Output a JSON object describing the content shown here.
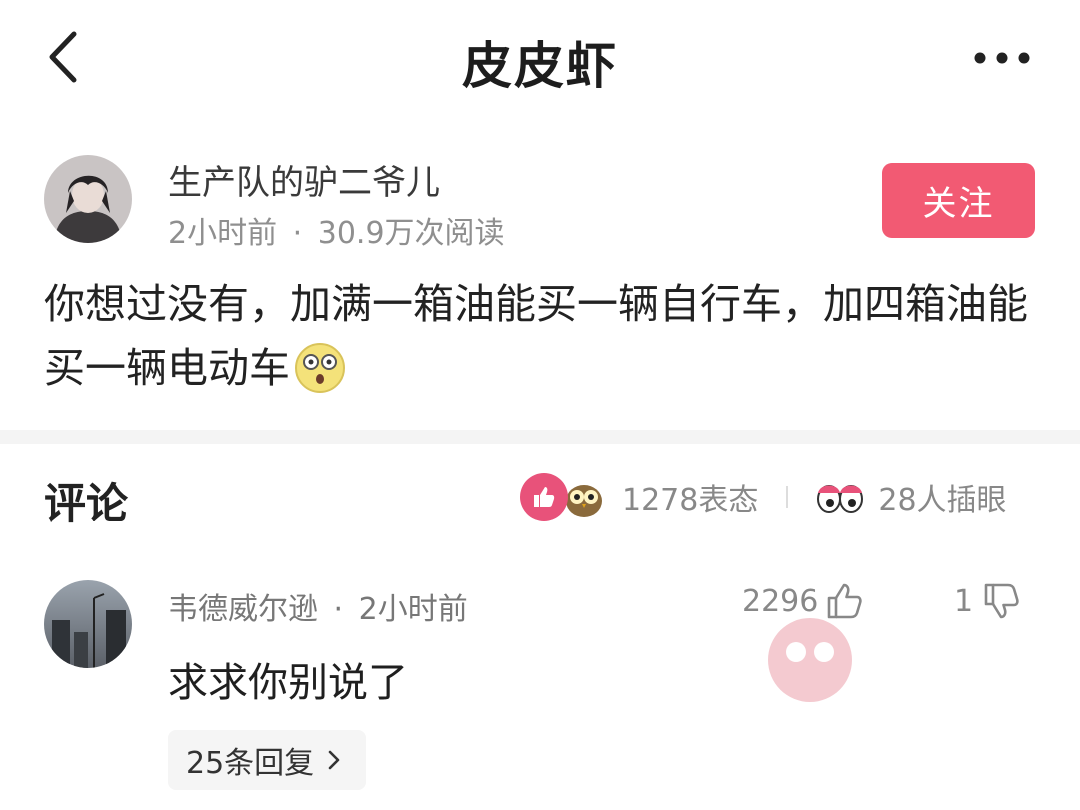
{
  "header": {
    "title": "皮皮虾",
    "back_icon": "chevron-left-icon",
    "more_icon": "more-dots-icon"
  },
  "post": {
    "author": "生产队的驴二爷儿",
    "time": "2小时前",
    "separator": "·",
    "reads": "30.9万次阅读",
    "follow_label": "关注",
    "text": "你想过没有，加满一箱油能买一辆自行车，加四箱油能买一辆电动车",
    "emoji": "shocked-face-emoji"
  },
  "comments_section": {
    "title": "评论",
    "reactions_count": "1278表态",
    "peek_count": "28人插眼"
  },
  "comment": {
    "user": "韦德威尔逊",
    "separator": "·",
    "time": "2小时前",
    "likes": "2296",
    "dislikes": "1",
    "text": "求求你别说了",
    "replies_label": "25条回复"
  },
  "colors": {
    "accent": "#f25a73",
    "like_badge": "#e8527a"
  }
}
